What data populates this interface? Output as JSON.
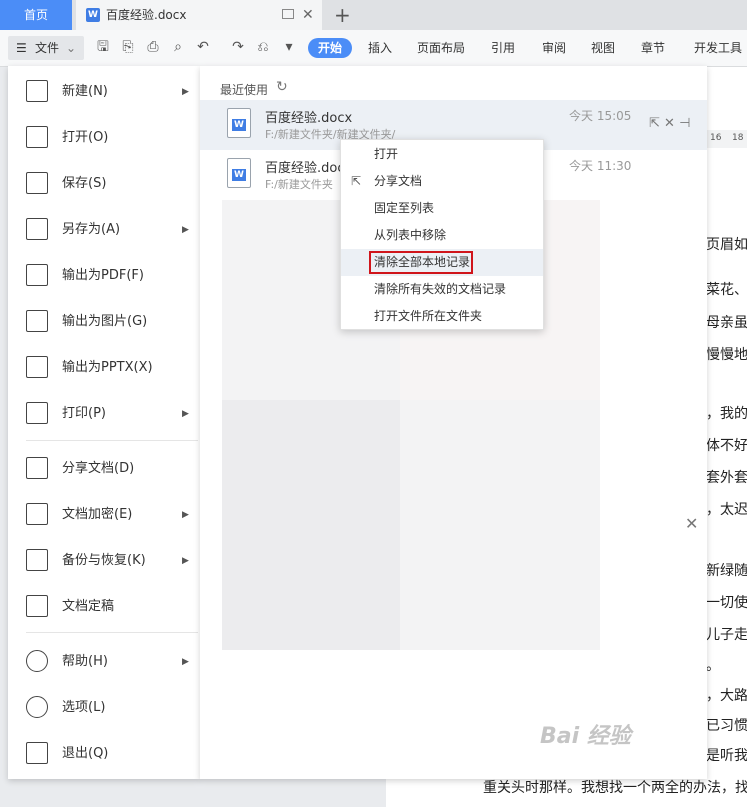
{
  "tabs": {
    "home": "首页",
    "doc_title": "百度经验.docx",
    "add": "+"
  },
  "toolbar": {
    "file_menu": "文件",
    "ribbon_tabs": [
      "开始",
      "插入",
      "页面布局",
      "引用",
      "审阅",
      "视图",
      "章节",
      "开发工具"
    ]
  },
  "file_menu": {
    "items": [
      {
        "label": "新建(N)",
        "icon": "new-file-icon",
        "submenu": true
      },
      {
        "label": "打开(O)",
        "icon": "folder-open-icon",
        "submenu": false
      },
      {
        "label": "保存(S)",
        "icon": "save-icon",
        "submenu": false
      },
      {
        "label": "另存为(A)",
        "icon": "save-as-icon",
        "submenu": true
      },
      {
        "label": "输出为PDF(F)",
        "icon": "pdf-icon",
        "submenu": false
      },
      {
        "label": "输出为图片(G)",
        "icon": "image-icon",
        "submenu": false
      },
      {
        "label": "输出为PPTX(X)",
        "icon": "pptx-icon",
        "submenu": false
      },
      {
        "label": "打印(P)",
        "icon": "print-icon",
        "submenu": true
      },
      {
        "label": "分享文档(D)",
        "icon": "share-icon",
        "submenu": false
      },
      {
        "label": "文档加密(E)",
        "icon": "encrypt-icon",
        "submenu": true
      },
      {
        "label": "备份与恢复(K)",
        "icon": "backup-icon",
        "submenu": true
      },
      {
        "label": "文档定稿",
        "icon": "finalize-icon",
        "submenu": false
      },
      {
        "label": "帮助(H)",
        "icon": "help-icon",
        "submenu": true
      },
      {
        "label": "选项(L)",
        "icon": "settings-icon",
        "submenu": false
      },
      {
        "label": "退出(Q)",
        "icon": "exit-icon",
        "submenu": false
      }
    ]
  },
  "recent": {
    "title": "最近使用",
    "files": [
      {
        "name": "百度经验.docx",
        "path": "F:/新建文件夹/新建文件夹/",
        "time": "今天  15:05"
      },
      {
        "name": "百度经验.doc",
        "path": "F:/新建文件夹",
        "time": "今天  11:30"
      }
    ]
  },
  "context_menu": {
    "items": [
      "打开",
      "分享文档",
      "固定至列表",
      "从列表中移除",
      "清除全部本地记录",
      "清除所有失效的文档记录",
      "打开文件所在文件夹"
    ]
  },
  "document": {
    "lines": [
      "页眉如",
      "菜花、裹",
      "母亲虽然",
      "慢慢地，",
      "，我的",
      "体不好",
      "套外套。",
      "，太迟",
      "新绿随",
      "一切使人",
      "儿子走",
      "。",
      "，大路",
      "已习惯听",
      "是听我的",
      "重关头时那样。我想找一个两全的办法，找"
    ],
    "ruler": [
      "16",
      "18"
    ]
  },
  "watermark": "Bai 经验"
}
